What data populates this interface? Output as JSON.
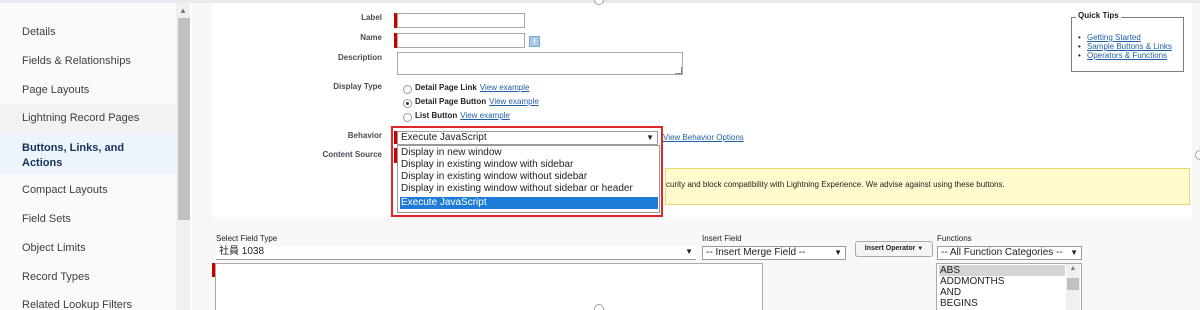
{
  "sidebar": {
    "items": [
      {
        "label": "Details"
      },
      {
        "label": "Fields & Relationships"
      },
      {
        "label": "Page Layouts"
      },
      {
        "label": "Lightning Record Pages"
      },
      {
        "label": "Buttons, Links, and Actions"
      },
      {
        "label": "Compact Layouts"
      },
      {
        "label": "Field Sets"
      },
      {
        "label": "Object Limits"
      },
      {
        "label": "Record Types"
      },
      {
        "label": "Related Lookup Filters"
      }
    ]
  },
  "form": {
    "label_label": "Label",
    "label_value": "",
    "name_label": "Name",
    "name_value": "",
    "info_glyph": "i",
    "description_label": "Description",
    "description_value": "",
    "display_type_label": "Display Type",
    "display_types": [
      {
        "label": "Detail Page Link",
        "link": "View example",
        "selected": false
      },
      {
        "label": "Detail Page Button",
        "link": "View example",
        "selected": true
      },
      {
        "label": "List Button",
        "link": "View example",
        "selected": false
      }
    ],
    "behavior_label": "Behavior",
    "behavior_value": "Execute JavaScript",
    "behavior_caret": "▼",
    "behavior_link": "View Behavior Options",
    "content_source_label": "Content Source",
    "behavior_options": [
      {
        "label": "Display in new window",
        "selected": false
      },
      {
        "label": "Display in existing window with sidebar",
        "selected": false
      },
      {
        "label": "Display in existing window without sidebar",
        "selected": false
      },
      {
        "label": "Display in existing window without sidebar or header",
        "selected": false
      },
      {
        "label": "Execute JavaScript",
        "selected": true
      }
    ],
    "warning_text": "curity and block compatibility with Lightning Experience. We advise against using these buttons."
  },
  "quick_tips": {
    "title": "Quick Tips",
    "links": [
      "Getting Started",
      "Sample Buttons & Links",
      "Operators & Functions"
    ]
  },
  "formula": {
    "select_field_type_label": "Select Field Type",
    "field_type_value": "社員 1038",
    "insert_field_label": "Insert Field",
    "insert_merge_value": "-- Insert Merge Field --",
    "insert_operator_label": "Insert Operator",
    "functions_label": "Functions",
    "functions_category_value": "-- All Function Categories --",
    "caret": "▼",
    "functions": [
      {
        "label": "ABS",
        "selected": true
      },
      {
        "label": "ADDMONTHS",
        "selected": false
      },
      {
        "label": "AND",
        "selected": false
      },
      {
        "label": "BEGINS",
        "selected": false
      }
    ]
  },
  "colors": {
    "highlight_border": "#e0262b",
    "selected_option": "#1e7cd8",
    "required_bar": "#cc0000",
    "warning_bg": "#fffbcc"
  }
}
